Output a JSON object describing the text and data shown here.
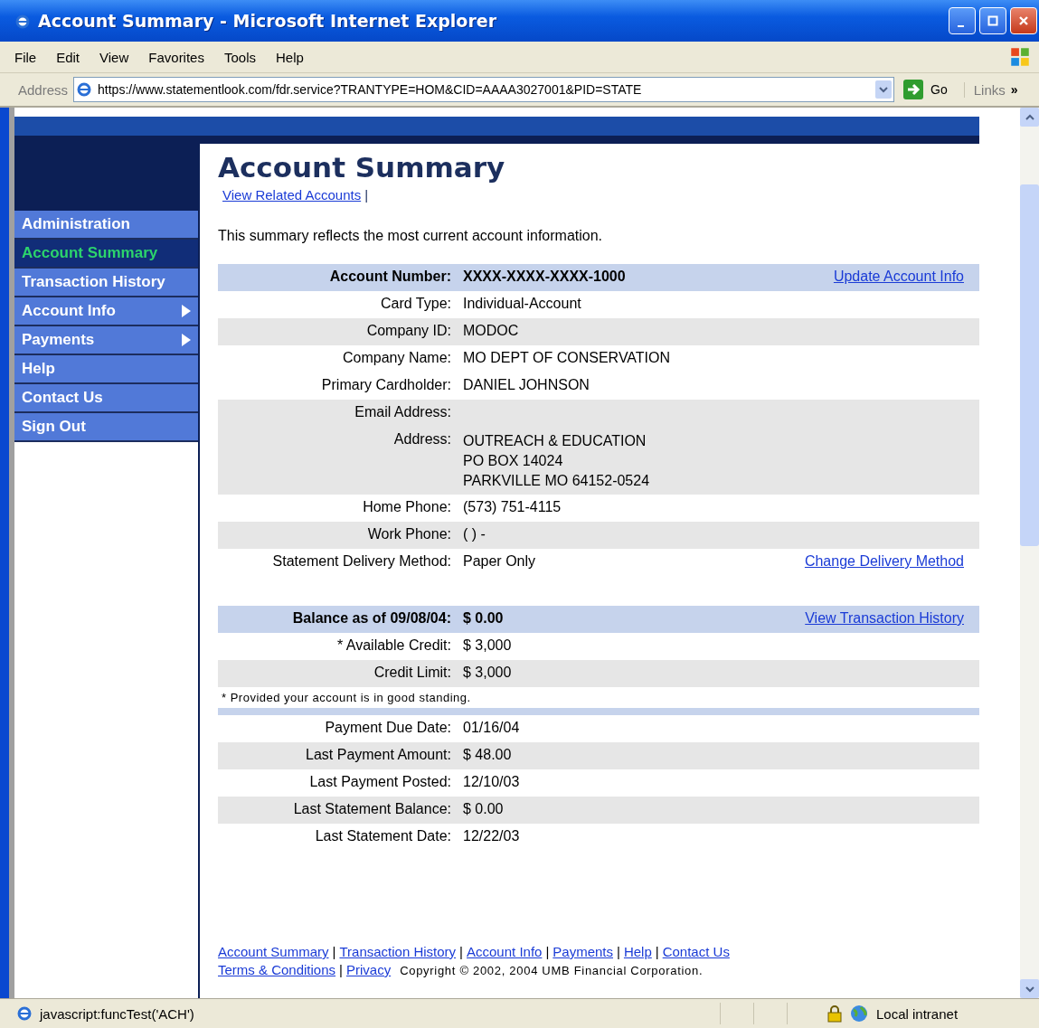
{
  "window": {
    "title": "Account Summary - Microsoft Internet Explorer"
  },
  "menu_bar": [
    "File",
    "Edit",
    "View",
    "Favorites",
    "Tools",
    "Help"
  ],
  "address_bar": {
    "label": "Address",
    "url": "https://www.statementlook.com/fdr.service?TRANTYPE=HOM&CID=AAAA3027001&PID=STATE",
    "go": "Go",
    "links": "Links",
    "more": "»"
  },
  "sidebar": {
    "items": [
      {
        "label": "Administration",
        "selected": false,
        "submenu": false
      },
      {
        "label": "Account Summary",
        "selected": true,
        "submenu": false
      },
      {
        "label": "Transaction History",
        "selected": false,
        "submenu": false
      },
      {
        "label": "Account Info",
        "selected": false,
        "submenu": true
      },
      {
        "label": "Payments",
        "selected": false,
        "submenu": true
      },
      {
        "label": "Help",
        "selected": false,
        "submenu": false
      },
      {
        "label": "Contact Us",
        "selected": false,
        "submenu": false
      },
      {
        "label": "Sign Out",
        "selected": false,
        "submenu": false
      }
    ]
  },
  "page": {
    "title": "Account Summary",
    "related_link": "View Related Accounts",
    "separator": "|",
    "intro": "This summary reflects the most current account information."
  },
  "account_section": {
    "rows": [
      {
        "kind": "header",
        "label": "Account Number:",
        "value": "XXXX-XXXX-XXXX-1000",
        "link": "Update Account Info",
        "shaded": true
      },
      {
        "kind": "row",
        "label": "Card Type:",
        "value": "Individual-Account",
        "shaded": false
      },
      {
        "kind": "row",
        "label": "Company ID:",
        "value": "MODOC",
        "shaded": true
      },
      {
        "kind": "row",
        "label": "Company Name:",
        "value": "MO DEPT OF CONSERVATION",
        "shaded": false
      },
      {
        "kind": "row",
        "label": "Primary Cardholder:",
        "value": "DANIEL JOHNSON",
        "shaded": false
      },
      {
        "kind": "row",
        "label": "Email Address:",
        "shaded": true
      },
      {
        "kind": "row",
        "label": "Address:",
        "lines": [
          "OUTREACH & EDUCATION",
          "PO BOX 14024",
          "PARKVILLE MO 64152-0524"
        ],
        "shaded": true
      },
      {
        "kind": "row",
        "label": "Home Phone:",
        "value": "(573) 751-4115",
        "shaded": false
      },
      {
        "kind": "row",
        "label": "Work Phone:",
        "value": "( ) -",
        "shaded": true
      },
      {
        "kind": "row",
        "label": "Statement Delivery Method:",
        "value": "Paper Only",
        "link": "Change Delivery Method",
        "shaded": false
      }
    ]
  },
  "balance_section": {
    "rows": [
      {
        "kind": "header",
        "label": "Balance as of 09/08/04:",
        "value": "$ 0.00",
        "link": "View Transaction History",
        "shaded": true
      },
      {
        "kind": "row",
        "label": "* Available Credit:",
        "value": "$ 3,000",
        "shaded": false
      },
      {
        "kind": "row",
        "label": "Credit Limit:",
        "value": "$ 3,000",
        "shaded": true
      },
      {
        "kind": "note",
        "text": "* Provided your account is in good standing."
      },
      {
        "kind": "strip",
        "shaded": true
      },
      {
        "kind": "row",
        "label": "Payment Due Date:",
        "value": "01/16/04",
        "shaded": false
      },
      {
        "kind": "row",
        "label": "Last Payment Amount:",
        "value": "$ 48.00",
        "shaded": true
      },
      {
        "kind": "row",
        "label": "Last Payment Posted:",
        "value": "12/10/03",
        "shaded": false
      },
      {
        "kind": "row",
        "label": "Last Statement Balance:",
        "value": "$ 0.00",
        "shaded": true
      },
      {
        "kind": "row",
        "label": "Last Statement Date:",
        "value": "12/22/03",
        "shaded": false
      }
    ]
  },
  "footer": {
    "links": [
      "Account Summary",
      "Transaction History",
      "Account Info",
      "Payments",
      "Help",
      "Contact Us"
    ],
    "legal_links": [
      "Terms & Conditions",
      "Privacy"
    ],
    "separator": "|",
    "copyright": "Copyright © 2002, 2004 UMB Financial Corporation."
  },
  "status_bar": {
    "text": "javascript:funcTest('ACH')",
    "zone": "Local intranet"
  }
}
